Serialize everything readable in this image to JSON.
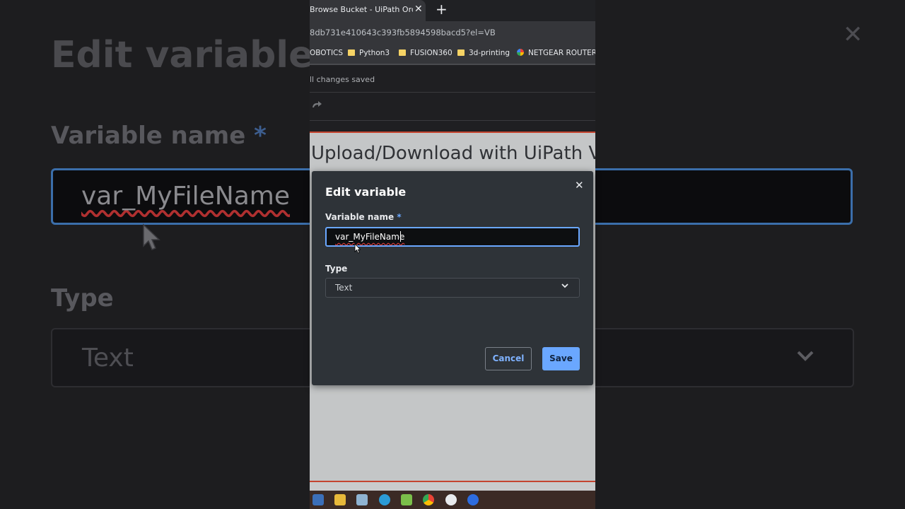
{
  "browser": {
    "tab_title": "Browse Bucket - UiPath Orchestr",
    "tab_close": "✕",
    "new_tab": "+",
    "url": "8db731e410643c393fb5894598bacd5?el=VB",
    "bookmarks": [
      {
        "label": "OBOTICS"
      },
      {
        "label": "Python3"
      },
      {
        "label": "FUSION360"
      },
      {
        "label": "3d-printing"
      },
      {
        "label": "NETGEAR ROUTER..."
      }
    ]
  },
  "app": {
    "save_status": "ll changes saved",
    "page_heading": "Upload/Download with UiPath V"
  },
  "dialog": {
    "title": "Edit variable",
    "close": "✕",
    "name_label": "Variable name",
    "required_mark": "*",
    "name_value": "var_MyFileName",
    "type_label": "Type",
    "type_value": "Text",
    "cancel_label": "Cancel",
    "save_label": "Save"
  },
  "background_zoom": {
    "title": "Edit variable",
    "close": "✕",
    "name_label": "Variable name",
    "required_mark": "*",
    "name_value": "var_MyFileName",
    "type_label": "Type",
    "type_value": "Text"
  },
  "colors": {
    "accent": "#6aa7ff",
    "dialog_bg": "#2e3338",
    "page_border": "#c4442f"
  }
}
